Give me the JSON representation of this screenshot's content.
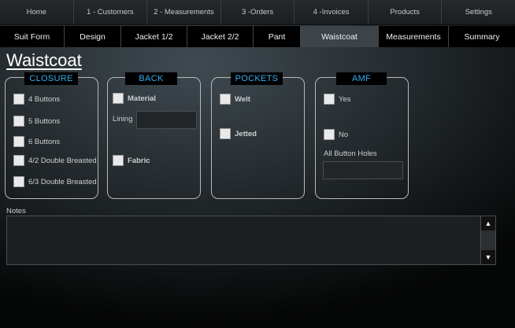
{
  "top_nav": [
    "Home",
    "1 - Customers",
    "2 - Measurements",
    "3 -Orders",
    "4 -Invoices",
    "Products",
    "Settings"
  ],
  "tabs": [
    "Suit Form",
    "Design",
    "Jacket 1/2",
    "Jacket 2/2",
    "Pant",
    "Waistcoat",
    "Measurements",
    "Summary"
  ],
  "active_tab": "Waistcoat",
  "page_title": "Waistcoat",
  "closure": {
    "title": "CLOSURE",
    "options": [
      "4 Buttons",
      "5 Buttons",
      "6 Buttons",
      "4/2 Double Breasted",
      "6/3 Double Breasted"
    ]
  },
  "back": {
    "title": "BACK",
    "material_label": "Material",
    "lining_label": "Lining",
    "lining_value": "",
    "fabric_label": "Fabric"
  },
  "pockets": {
    "title": "POCKETS",
    "options": [
      "Welt",
      "Jetted"
    ]
  },
  "amf": {
    "title": "AMF",
    "yes_label": "Yes",
    "no_label": "No",
    "holes_label": "All Button Holes",
    "holes_value": ""
  },
  "notes": {
    "label": "Notes",
    "value": "",
    "scroll_up": "▲",
    "scroll_down": "▼"
  },
  "colors": {
    "section_heading": "#35aef0",
    "active_tab_bg": "#3d4449"
  }
}
